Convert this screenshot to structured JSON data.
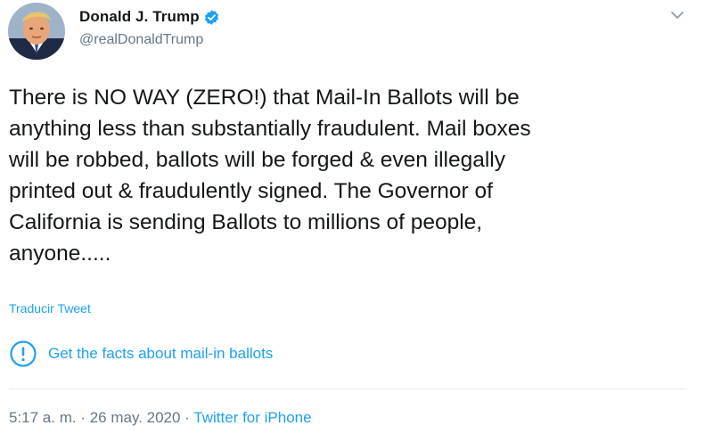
{
  "user": {
    "display_name": "Donald J. Trump",
    "handle": "@realDonaldTrump",
    "verified": true,
    "avatar_icon": "profile-photo"
  },
  "menu": {
    "icon": "chevron-down-icon"
  },
  "tweet": {
    "text": "There is NO WAY (ZERO!) that Mail-In Ballots will be\nanything less than substantially fraudulent. Mail boxes\nwill be robbed, ballots will be forged & even illegally\nprinted out & fraudulently signed. The Governor of\nCalifornia is sending Ballots to millions of people,\nanyone....."
  },
  "translate_label": "Traducir Tweet",
  "fact_check": {
    "icon": "exclamation-circle-icon",
    "label": "Get the facts about mail-in ballots"
  },
  "meta": {
    "time": "5:17 a. m.",
    "separator": " · ",
    "date": "26 may. 2020",
    "source": "Twitter for iPhone"
  },
  "colors": {
    "link": "#1da1f2",
    "secondary_text": "#657786",
    "primary_text": "#14171a"
  }
}
